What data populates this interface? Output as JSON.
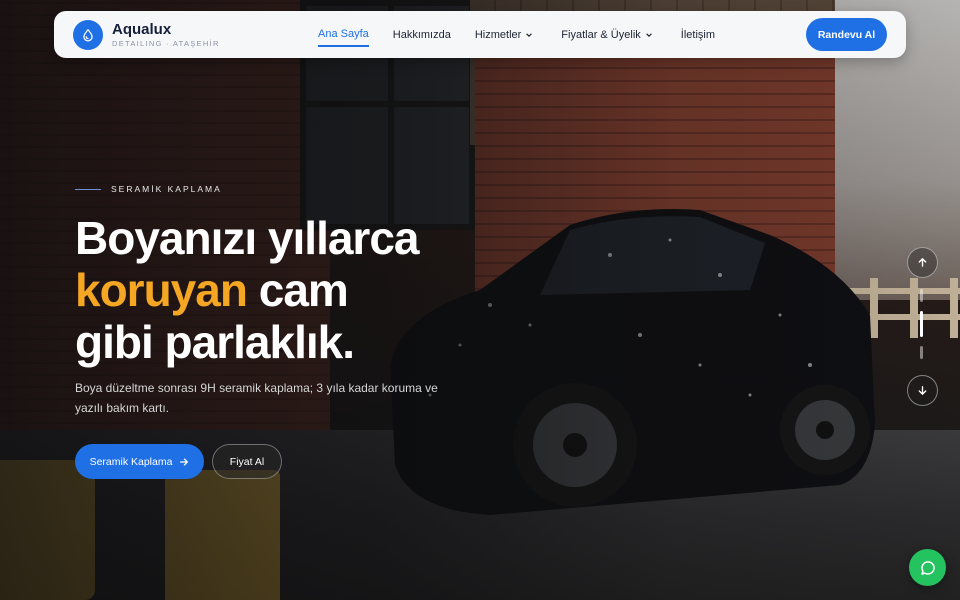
{
  "brand": {
    "name": "Aqualux",
    "subtitle": "DETAILING · ATAŞEHİR",
    "icon": "water-drop-icon",
    "color": "#1f6fe5"
  },
  "nav": {
    "items": [
      {
        "label": "Ana Sayfa",
        "active": true,
        "dropdown": false
      },
      {
        "label": "Hakkımızda",
        "active": false,
        "dropdown": false
      },
      {
        "label": "Hizmetler",
        "active": false,
        "dropdown": true
      },
      {
        "label": "Fiyatlar & Üyelik",
        "active": false,
        "dropdown": true
      },
      {
        "label": "İletişim",
        "active": false,
        "dropdown": false
      }
    ],
    "cta_label": "Randevu Al"
  },
  "hero": {
    "eyebrow": "SERAMİK KAPLAMA",
    "headline_line1": "Boyanızı yıllarca",
    "headline_accent": "koruyan",
    "headline_line2_rest": " cam",
    "headline_line3": "gibi parlaklık.",
    "lead": "Boya düzeltme sonrası 9H seramik kaplama; 3 yıla kadar koruma ve yazılı bakım kartı.",
    "primary_button": "Seramik Kaplama",
    "secondary_button": "Fiyat Al",
    "accent_color": "#f5a623"
  },
  "slider": {
    "slide_count": 3,
    "active_index": 1,
    "up_icon": "arrow-up-icon",
    "down_icon": "arrow-down-icon"
  },
  "chat": {
    "icon": "whatsapp-icon",
    "color": "#25c35f"
  }
}
